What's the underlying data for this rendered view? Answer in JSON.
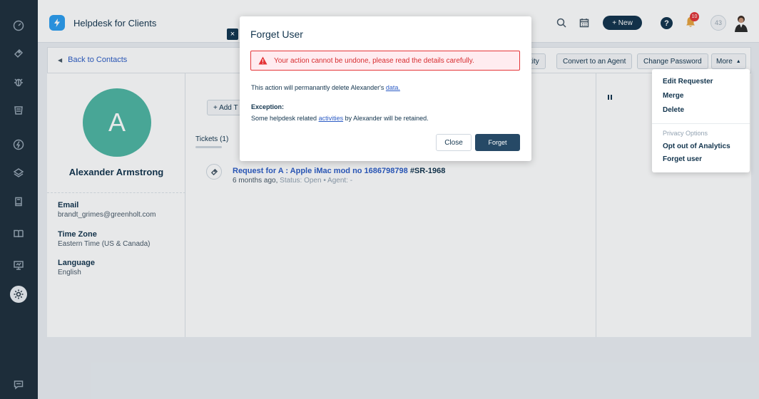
{
  "app": {
    "title": "Helpdesk for Clients"
  },
  "header": {
    "new_label": "+ New",
    "help_label": "?",
    "notification_count": "10",
    "account_initials": "43"
  },
  "toolbar": {
    "back_label": "Back to Contacts",
    "identity_label": "tity",
    "convert_label": "Convert to an Agent",
    "change_password_label": "Change Password",
    "more_label": "More"
  },
  "contact": {
    "initial": "A",
    "name": "Alexander Armstrong",
    "fields": [
      {
        "label": "Email",
        "value": "brandt_grimes@greenholt.com"
      },
      {
        "label": "Time Zone",
        "value": "Eastern Time (US & Canada)"
      },
      {
        "label": "Language",
        "value": "English"
      }
    ]
  },
  "main": {
    "add_label": "+ Add T",
    "tickets_tab": "Tickets (1)",
    "ticket": {
      "title": "Request for A : Apple iMac mod no 1686798798",
      "id": "#SR-1968",
      "age": "6 months ago,",
      "status": "Status: Open",
      "agent": "• Agent: -"
    }
  },
  "more_menu": {
    "items": [
      "Edit Requester",
      "Merge",
      "Delete"
    ],
    "privacy_heading": "Privacy Options",
    "privacy_items": [
      "Opt out of Analytics",
      "Forget user"
    ]
  },
  "modal": {
    "close_x": "×",
    "title": "Forget User",
    "warning": "Your action cannot be undone, please read the details carefully.",
    "line1_prefix": "This action will permanantly delete Alexander's",
    "line1_link": "data.",
    "exception_heading": "Exception:",
    "line2_prefix": "Some helpdesk related",
    "line2_link": "activities",
    "line2_suffix": "by Alexander will be retained.",
    "close_label": "Close",
    "forget_label": "Forget"
  },
  "colors": {
    "nav_bg": "#1f2f3d",
    "brand": "#2c9ef0",
    "avatar": "#4fb6a3",
    "link": "#2c5cc5",
    "danger": "#e43538",
    "primary_btn": "#264966"
  },
  "icons": {
    "nav": [
      "dashboard-icon",
      "tickets-icon",
      "bug-icon",
      "inbox-icon",
      "bolt-icon",
      "layers-icon",
      "book-icon",
      "open-book-icon",
      "presentation-icon",
      "settings-icon",
      "chat-icon"
    ],
    "header": [
      "search-icon",
      "calendar-icon",
      "help-icon",
      "bell-icon",
      "account-icon",
      "avatar"
    ]
  }
}
